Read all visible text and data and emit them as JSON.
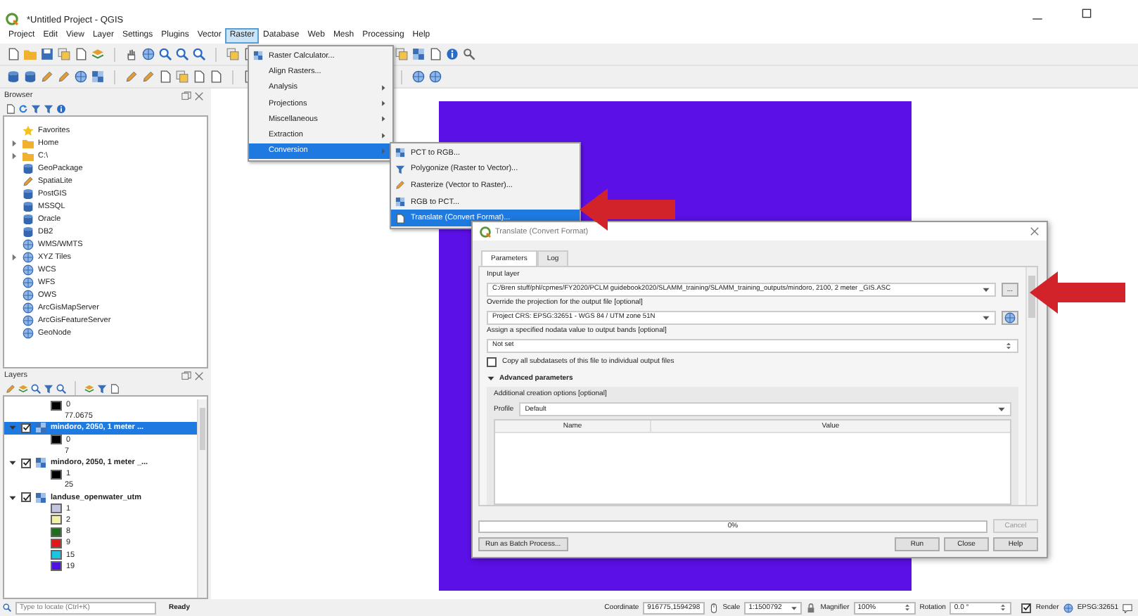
{
  "window": {
    "title": "*Untitled Project - QGIS"
  },
  "menubar": [
    {
      "label": "Project",
      "selected": false
    },
    {
      "label": "Edit",
      "selected": false
    },
    {
      "label": "View",
      "selected": false
    },
    {
      "label": "Layer",
      "selected": false
    },
    {
      "label": "Settings",
      "selected": false
    },
    {
      "label": "Plugins",
      "selected": false
    },
    {
      "label": "Vector",
      "selected": false
    },
    {
      "label": "Raster",
      "selected": true
    },
    {
      "label": "Database",
      "selected": false
    },
    {
      "label": "Web",
      "selected": false
    },
    {
      "label": "Mesh",
      "selected": false
    },
    {
      "label": "Processing",
      "selected": false
    },
    {
      "label": "Help",
      "selected": false
    }
  ],
  "raster_menu": [
    {
      "label": "Raster Calculator...",
      "submenu": false,
      "selected": false
    },
    {
      "label": "Align Rasters...",
      "submenu": false,
      "selected": false
    },
    {
      "label": "Analysis",
      "submenu": true,
      "selected": false
    },
    {
      "label": "Projections",
      "submenu": true,
      "selected": false
    },
    {
      "label": "Miscellaneous",
      "submenu": true,
      "selected": false
    },
    {
      "label": "Extraction",
      "submenu": true,
      "selected": false
    },
    {
      "label": "Conversion",
      "submenu": true,
      "selected": true
    }
  ],
  "conversion_submenu": [
    {
      "label": "PCT to RGB...",
      "selected": false
    },
    {
      "label": "Polygonize (Raster to Vector)...",
      "selected": false
    },
    {
      "label": "Rasterize (Vector to Raster)...",
      "selected": false
    },
    {
      "label": "RGB to PCT...",
      "selected": false
    },
    {
      "label": "Translate (Convert Format)...",
      "selected": true
    }
  ],
  "browser": {
    "title": "Browser",
    "items": [
      {
        "label": "Favorites",
        "expandable": false
      },
      {
        "label": "Home",
        "expandable": true
      },
      {
        "label": "C:\\",
        "expandable": true
      },
      {
        "label": "GeoPackage",
        "expandable": false
      },
      {
        "label": "SpatiaLite",
        "expandable": false
      },
      {
        "label": "PostGIS",
        "expandable": false
      },
      {
        "label": "MSSQL",
        "expandable": false
      },
      {
        "label": "Oracle",
        "expandable": false
      },
      {
        "label": "DB2",
        "expandable": false
      },
      {
        "label": "WMS/WMTS",
        "expandable": false
      },
      {
        "label": "XYZ Tiles",
        "expandable": true
      },
      {
        "label": "WCS",
        "expandable": false
      },
      {
        "label": "WFS",
        "expandable": false
      },
      {
        "label": "OWS",
        "expandable": false
      },
      {
        "label": "ArcGisMapServer",
        "expandable": false
      },
      {
        "label": "ArcGisFeatureServer",
        "expandable": false
      },
      {
        "label": "GeoNode",
        "expandable": false
      }
    ]
  },
  "layers": {
    "title": "Layers",
    "tree": [
      {
        "kind": "legend",
        "label": "0",
        "color": "#000000"
      },
      {
        "kind": "legend",
        "label": "77.0675"
      },
      {
        "kind": "layer",
        "name": "mindoro, 2050, 1 meter ...",
        "checked": true,
        "selected": true,
        "expanded": true,
        "children": [
          {
            "kind": "legend",
            "label": "0",
            "color": "#000000"
          },
          {
            "kind": "legend",
            "label": "7"
          }
        ]
      },
      {
        "kind": "layer",
        "name": "mindoro, 2050, 1 meter _...",
        "checked": true,
        "selected": false,
        "expanded": true,
        "children": [
          {
            "kind": "legend",
            "label": "1",
            "color": "#000000"
          },
          {
            "kind": "legend",
            "label": "25"
          }
        ]
      },
      {
        "kind": "layer",
        "name": "landuse_openwater_utm",
        "checked": true,
        "selected": false,
        "expanded": true,
        "children": [
          {
            "kind": "legend",
            "label": "1",
            "color": "#c4c4dc"
          },
          {
            "kind": "legend",
            "label": "2",
            "color": "#f2f0a8"
          },
          {
            "kind": "legend",
            "label": "8",
            "color": "#1e6e1e"
          },
          {
            "kind": "legend",
            "label": "9",
            "color": "#e01818"
          },
          {
            "kind": "legend",
            "label": "15",
            "color": "#18c4e0"
          },
          {
            "kind": "legend",
            "label": "19",
            "color": "#5010e0"
          }
        ]
      }
    ]
  },
  "dialog": {
    "title": "Translate (Convert Format)",
    "tabs": [
      {
        "label": "Parameters",
        "selected": true
      },
      {
        "label": "Log",
        "selected": false
      }
    ],
    "input_layer_label": "Input layer",
    "input_layer": "C:/Bren stuff/phl/cpmes/FY2020/PCLM guidebook2020/SLAMM_training/SLAMM_training_outputs/mindoro, 2100, 2 meter _GIS.ASC",
    "browse_button": "...",
    "projection_label": "Override the projection for the output file [optional]",
    "projection": "Project CRS: EPSG:32651 - WGS 84 / UTM zone 51N",
    "nodata_label": "Assign a specified nodata value to output bands [optional]",
    "nodata": "Not set",
    "copy_subdatasets": {
      "label": "Copy all subdatasets of this file to individual output files",
      "checked": false
    },
    "advanced": {
      "label": "Advanced parameters",
      "expanded": true,
      "options_label": "Additional creation options [optional]",
      "profile_label": "Profile",
      "profile": "Default",
      "columns": [
        "Name",
        "Value"
      ]
    },
    "progress": {
      "label": "0%",
      "level": 0
    },
    "cancel": {
      "label": "Cancel",
      "disabled": true
    },
    "batch_button": "Run as Batch Process...",
    "buttons": [
      "Run",
      "Close",
      "Help"
    ]
  },
  "status_bar": {
    "locator_placeholder": "Type to locate (Ctrl+K)",
    "message": "Ready",
    "coordinate_label": "Coordinate",
    "coordinate": "916775,1594298",
    "scale_label": "Scale",
    "scale": "1:1500792",
    "magnifier_label": "Magnifier",
    "magnifier": "100%",
    "rotation_label": "Rotation",
    "rotation": "0.0 °",
    "render": {
      "label": "Render",
      "checked": true
    },
    "crs": "EPSG:32651"
  }
}
